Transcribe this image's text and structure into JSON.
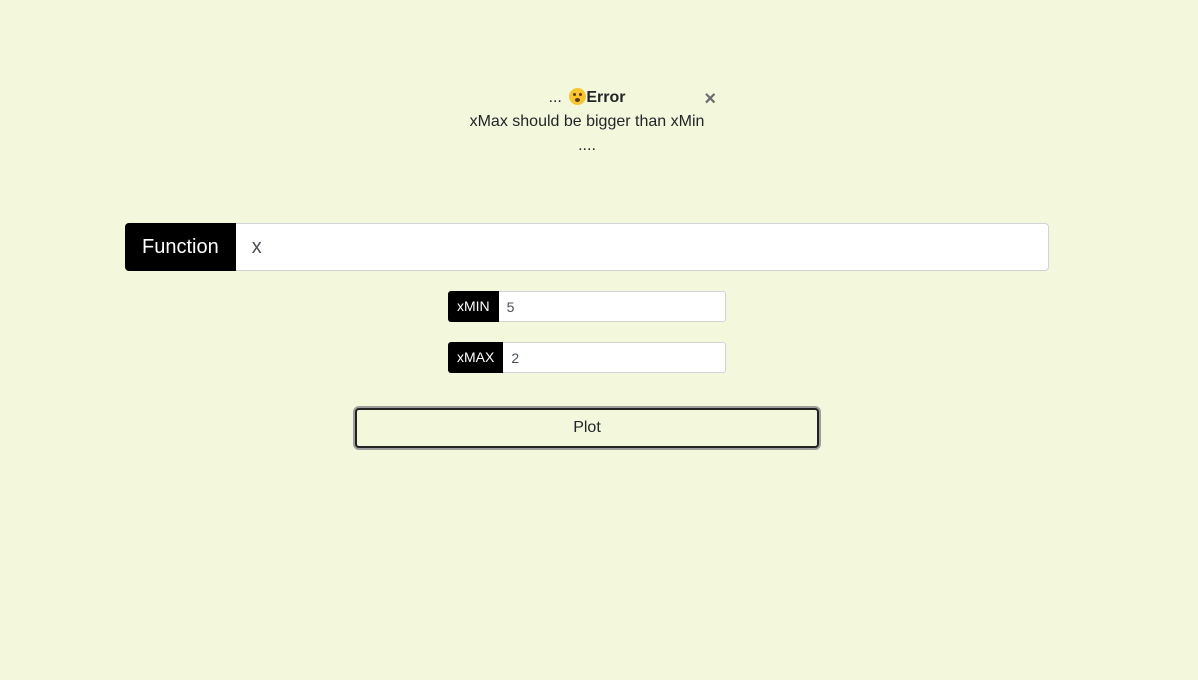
{
  "alert": {
    "prefix": "...",
    "emoji_icon": "worried-face-icon",
    "heading": "Error",
    "close_symbol": "×",
    "message": "xMax should be bigger than xMin",
    "trailer": "...."
  },
  "function_input": {
    "label": "Function",
    "value": "x"
  },
  "xmin_input": {
    "label": "xMIN",
    "value": "5"
  },
  "xmax_input": {
    "label": "xMAX",
    "value": "2"
  },
  "plot_button": {
    "label": "Plot"
  },
  "colors": {
    "background": "#f3f8dc",
    "label_background": "#000000",
    "label_text": "#ffffff"
  }
}
